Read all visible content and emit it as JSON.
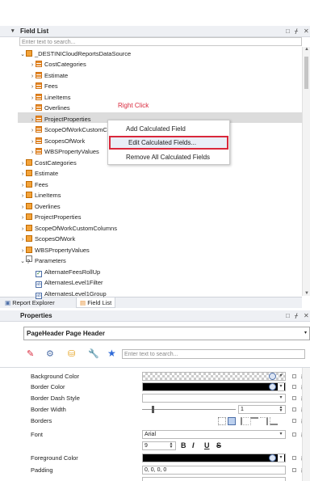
{
  "field_list": {
    "title": "Field List",
    "search_placeholder": "Enter text to search...",
    "root": "_DESTINICloudReportsDataSource",
    "root_children": [
      "CostCategories",
      "Estimate",
      "Fees",
      "LineItems",
      "Overlines",
      "ProjectProperties",
      "ScopeOfWorkCustomC",
      "ScopesOfWork",
      "WBSPropertyValues"
    ],
    "top_items": [
      "CostCategories",
      "Estimate",
      "Fees",
      "LineItems",
      "Overlines",
      "ProjectProperties",
      "ScopeOfWorkCustomColumns",
      "ScopesOfWork",
      "WBSPropertyValues"
    ],
    "parameters_label": "Parameters",
    "parameters": [
      "AlternateFeesRollUp",
      "AlternatesLevel1Filter",
      "AlternatesLevel1Group"
    ]
  },
  "annotation": {
    "text": "Right Click",
    "color": "#d9273b"
  },
  "context_menu": {
    "items": [
      "Add Calculated Field",
      "Edit Calculated Fields...",
      "Remove All Calculated Fields"
    ]
  },
  "tabs": {
    "report_explorer": "Report Explorer",
    "field_list": "Field List"
  },
  "properties": {
    "title": "Properties",
    "selector": "PageHeader  Page Header",
    "search_placeholder": "Enter text to search...",
    "rows": {
      "background_color": "Background Color",
      "border_color": "Border Color",
      "border_dash_style": "Border Dash Style",
      "border_width": "Border Width",
      "border_width_value": "1",
      "borders": "Borders",
      "font": "Font",
      "font_name": "Arial",
      "font_size": "9",
      "foreground_color": "Foreground Color",
      "padding": "Padding",
      "padding_value": "0, 0, 0, 0"
    },
    "font_styles": [
      "B",
      "I",
      "U",
      "S"
    ]
  },
  "colors": {
    "accent": "#4d6fa8",
    "highlight_border": "#d9273b",
    "selected_row": "#dcdcdc"
  }
}
